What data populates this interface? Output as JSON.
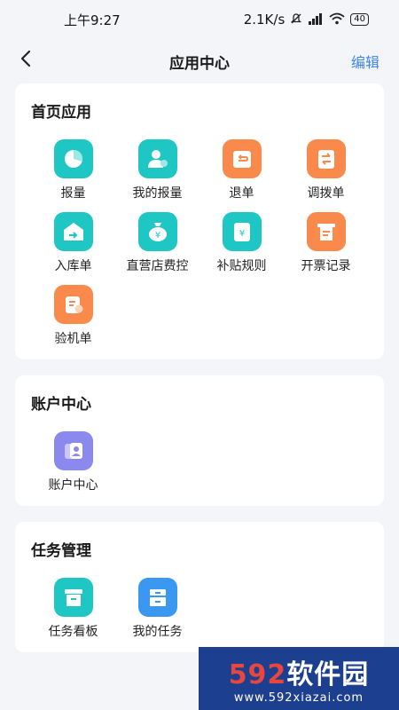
{
  "status_bar": {
    "time": "上午9:27",
    "speed": "2.1K/s",
    "battery": "40"
  },
  "header": {
    "back_icon": "chevron-left-icon",
    "title": "应用中心",
    "edit_label": "编辑"
  },
  "sections": [
    {
      "title": "首页应用",
      "items": [
        {
          "label": "报量",
          "icon": "pie-chart-icon",
          "color": "#1ec7c3"
        },
        {
          "label": "我的报量",
          "icon": "person-report-icon",
          "color": "#1ec7c3"
        },
        {
          "label": "退单",
          "icon": "return-box-icon",
          "color": "#f98a4c"
        },
        {
          "label": "调拨单",
          "icon": "transfer-doc-icon",
          "color": "#f98a4c"
        },
        {
          "label": "入库单",
          "icon": "warehouse-in-icon",
          "color": "#1ec7c3"
        },
        {
          "label": "直营店费控",
          "icon": "money-bag-icon",
          "color": "#1ec7c3"
        },
        {
          "label": "补贴规则",
          "icon": "subsidy-wallet-icon",
          "color": "#1ec7c3"
        },
        {
          "label": "开票记录",
          "icon": "invoice-icon",
          "color": "#f98a4c"
        },
        {
          "label": "验机单",
          "icon": "inspection-clipboard-icon",
          "color": "#f98a4c"
        }
      ]
    },
    {
      "title": "账户中心",
      "items": [
        {
          "label": "账户中心",
          "icon": "account-card-icon",
          "color": "#8b89ee"
        }
      ]
    },
    {
      "title": "任务管理",
      "items": [
        {
          "label": "任务看板",
          "icon": "task-board-icon",
          "color": "#1ec7c3"
        },
        {
          "label": "我的任务",
          "icon": "my-task-icon",
          "color": "#3a98f0"
        }
      ]
    }
  ],
  "watermark": {
    "brand_num": "592",
    "brand_text": "软件园",
    "url": "www.592xiazai.com"
  }
}
